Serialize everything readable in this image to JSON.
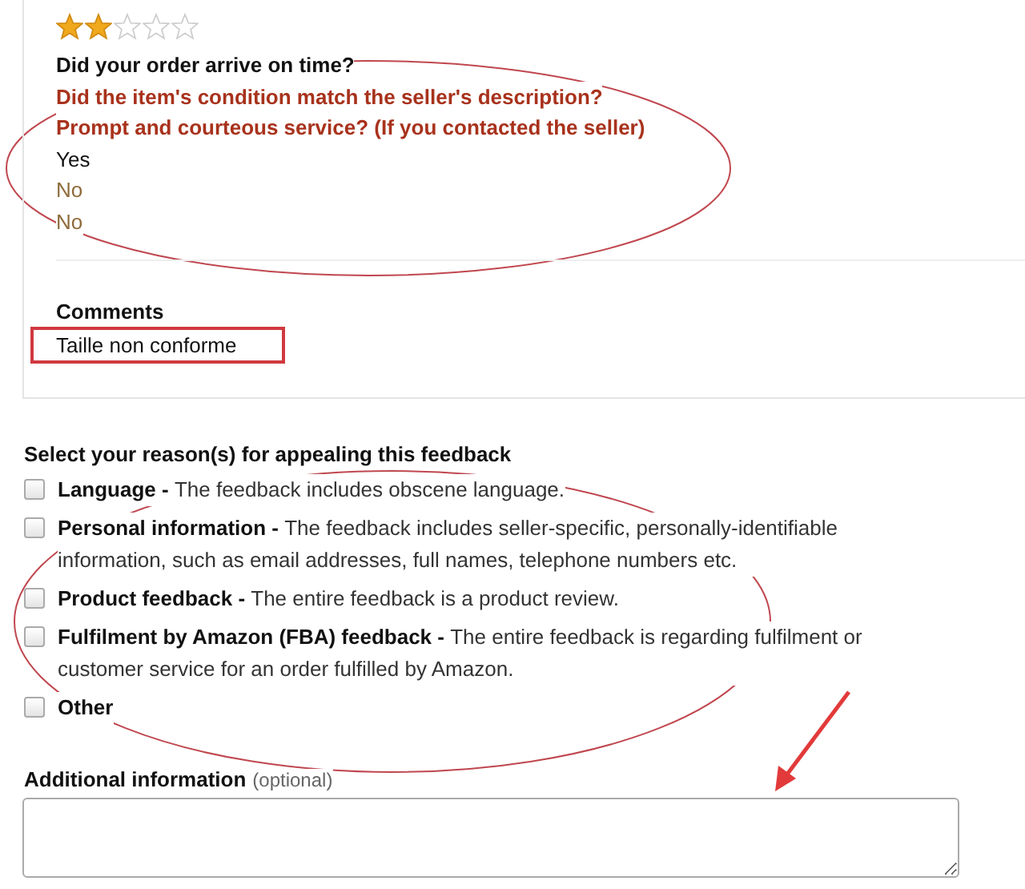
{
  "rating": {
    "stars": 2
  },
  "questions": [
    {
      "text": "Did your order arrive on time?",
      "highlighted": false
    },
    {
      "text": "Did the item's condition match the seller's description?",
      "highlighted": true
    },
    {
      "text": "Prompt and courteous service? (If you contacted the seller)",
      "highlighted": true
    }
  ],
  "answers": [
    {
      "text": "Yes",
      "negative": false
    },
    {
      "text": "No",
      "negative": true
    },
    {
      "text": "No",
      "negative": true
    }
  ],
  "comments": {
    "label": "Comments",
    "value": "Taille non conforme"
  },
  "appeal": {
    "heading": "Select your reason(s) for appealing this feedback",
    "reasons": [
      {
        "title": "Language - ",
        "description": "The feedback includes obscene language.",
        "checked": false
      },
      {
        "title": "Personal information - ",
        "description": "The feedback includes seller-specific, personally-identifiable information, such as email addresses, full names, telephone numbers etc.",
        "checked": false
      },
      {
        "title": "Product feedback - ",
        "description": "The entire feedback is a product review.",
        "checked": false
      },
      {
        "title": "Fulfilment by Amazon (FBA) feedback - ",
        "description": "The entire feedback is regarding fulfilment or customer service for an order fulfilled by Amazon.",
        "checked": false
      },
      {
        "title": "Other",
        "checked": false
      }
    ]
  },
  "additional": {
    "label": "Additional information",
    "hint": "(optional)"
  }
}
